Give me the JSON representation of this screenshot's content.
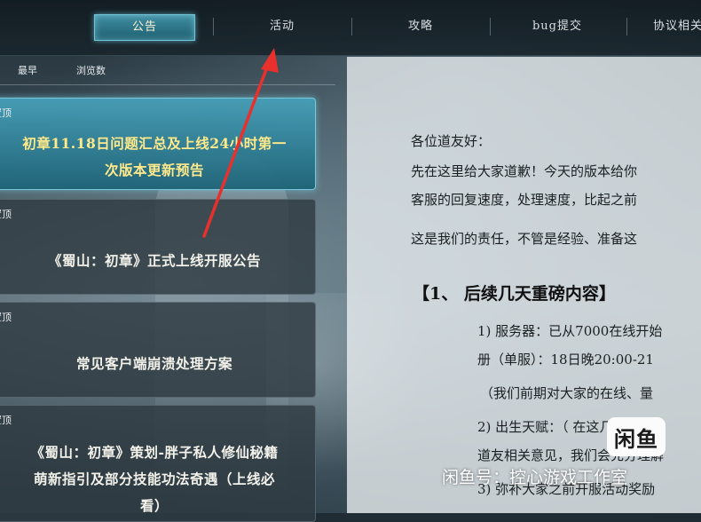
{
  "topnav": {
    "tabs": [
      {
        "label": "公告",
        "active": true
      },
      {
        "label": "活动",
        "active": false
      },
      {
        "label": "攻略",
        "active": false
      },
      {
        "label": "bug提交",
        "active": false
      },
      {
        "label": "协议相关",
        "active": false
      }
    ]
  },
  "sortbar": {
    "options": [
      "最早",
      "浏览数"
    ]
  },
  "list": {
    "items": [
      {
        "tag": "置顶",
        "title_lines": [
          "初章11.18日问题汇总及上线24小时第一",
          "次版本更新预告"
        ],
        "highlight": true
      },
      {
        "tag": "置顶",
        "title_lines": [
          "《蜀山：初章》正式上线开服公告"
        ],
        "highlight": false
      },
      {
        "tag": "置顶",
        "title_lines": [
          "常见客户端崩溃处理方案"
        ],
        "highlight": false
      },
      {
        "tag": "置顶",
        "title_lines": [
          "《蜀山：初章》策划-胖子私人修仙秘籍",
          "萌新指引及部分技能功法奇遇（上线必",
          "看）"
        ],
        "highlight": false
      }
    ]
  },
  "article": {
    "greeting": "各位道友好：",
    "para1_l1": "先在这里给大家道歉！今天的版本给你",
    "para1_l2": "客服的回复速度，处理速度，比起之前",
    "para1_l3": "这是我们的责任，不管是经验、准备这",
    "section_title": "【1、  后续几天重磅内容】",
    "item1_l1": "1) 服务器：已从7000在线开始",
    "item1_l2": "册（单服）：18日晚20:00-21",
    "item1_note": "（我们前期对大家的在线、量",
    "item2_l1": "2) 出生天赋：（               在这几",
    "item2_l2": "道友相关意见，我们会充分理解",
    "item3_l1": "3) 弥补大家之前开服活动奖励"
  },
  "watermark": {
    "logo_text": "闲鱼",
    "text": "闲鱼号：控心游戏工作室"
  },
  "colors": {
    "accent_tab": "#3f8ea1",
    "highlight_title": "#ffe98a",
    "arrow": "#e8312c"
  }
}
